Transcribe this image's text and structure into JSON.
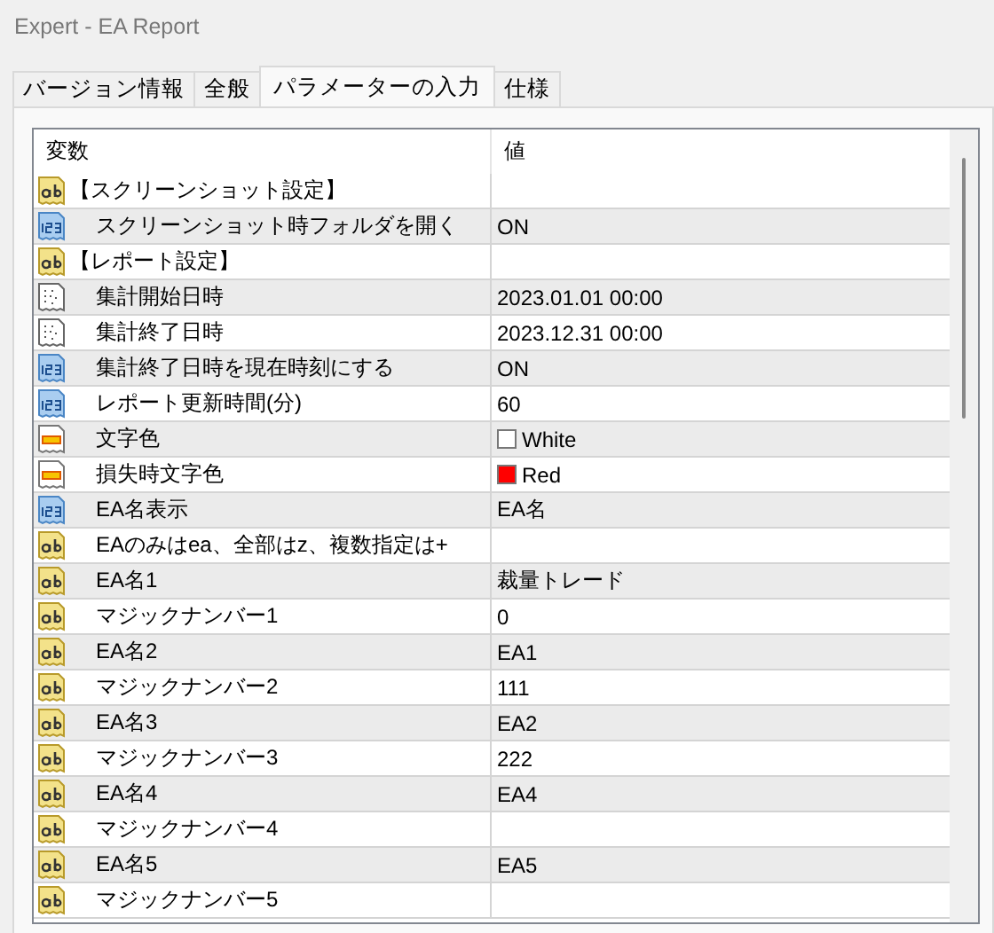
{
  "window": {
    "title": "Expert - EA Report"
  },
  "tabs": [
    {
      "label": "バージョン情報",
      "selected": false
    },
    {
      "label": "全般",
      "selected": false
    },
    {
      "label": "パラメーターの入力",
      "selected": true
    },
    {
      "label": "仕様",
      "selected": false
    }
  ],
  "table": {
    "columns": [
      "変数",
      "値"
    ],
    "rows": [
      {
        "kind": "string",
        "name": "【スクリーンショット設定】",
        "children": [
          {
            "kind": "int",
            "name": "スクリーンショット時フォルダを開く",
            "value": "ON"
          }
        ]
      },
      {
        "kind": "string",
        "name": "【レポート設定】",
        "children": [
          {
            "kind": "datetime",
            "name": "集計開始日時",
            "value": "2023.01.01 00:00"
          },
          {
            "kind": "datetime",
            "name": "集計終了日時",
            "value": "2023.12.31 00:00"
          },
          {
            "kind": "int",
            "name": "集計終了日時を現在時刻にする",
            "value": "ON"
          },
          {
            "kind": "int",
            "name": "レポート更新時間(分)",
            "value": "60"
          },
          {
            "kind": "color",
            "name": "文字色",
            "value": "White",
            "color": "#ffffff"
          },
          {
            "kind": "color",
            "name": "損失時文字色",
            "value": "Red",
            "color": "#ff0000"
          },
          {
            "kind": "int",
            "name": "EA名表示",
            "value": "EA名"
          },
          {
            "kind": "string",
            "name": "EAのみはea、全部はz、複数指定は+"
          },
          {
            "kind": "string",
            "name": "EA名1",
            "value": "裁量トレード"
          },
          {
            "kind": "string",
            "name": "マジックナンバー1",
            "value": "0"
          },
          {
            "kind": "string",
            "name": "EA名2",
            "value": "EA1"
          },
          {
            "kind": "string",
            "name": "マジックナンバー2",
            "value": "111"
          },
          {
            "kind": "string",
            "name": "EA名3",
            "value": "EA2"
          },
          {
            "kind": "string",
            "name": "マジックナンバー3",
            "value": "222"
          },
          {
            "kind": "string",
            "name": "EA名4",
            "value": "EA4"
          },
          {
            "kind": "string",
            "name": "マジックナンバー4"
          },
          {
            "kind": "string",
            "name": "EA名5",
            "value": "EA5"
          },
          {
            "kind": "string",
            "name": "マジックナンバー5"
          }
        ]
      }
    ]
  }
}
